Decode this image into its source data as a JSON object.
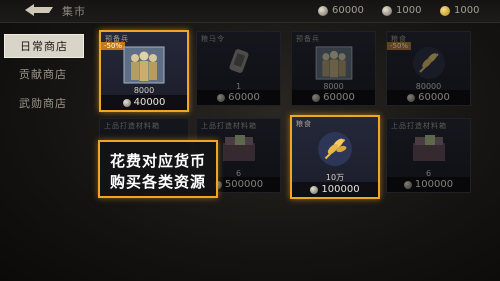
{
  "header": {
    "title": "集市",
    "currencies": [
      {
        "icon": "silver-coin-icon",
        "value": "60000"
      },
      {
        "icon": "silver-coin-icon",
        "value": "1000"
      },
      {
        "icon": "gold-coin-icon",
        "value": "1000"
      }
    ]
  },
  "sidebar": {
    "items": [
      {
        "label": "日常商店",
        "active": true
      },
      {
        "label": "贡献商店",
        "active": false
      },
      {
        "label": "武勋商店",
        "active": false
      }
    ]
  },
  "shop": {
    "cards": [
      {
        "name": "预备兵",
        "discount": "-50%",
        "qty": "8000",
        "price": "40000",
        "art": "soldiers-icon",
        "highlighted": true,
        "dimmed": false
      },
      {
        "name": "粮马令",
        "discount": "",
        "qty": "1",
        "price": "60000",
        "art": "token-icon",
        "highlighted": false,
        "dimmed": true
      },
      {
        "name": "预备兵",
        "discount": "",
        "qty": "8000",
        "price": "60000",
        "art": "soldiers-icon",
        "highlighted": false,
        "dimmed": true
      },
      {
        "name": "粮食",
        "discount": "-50%",
        "qty": "80000",
        "price": "60000",
        "art": "wheat-icon",
        "highlighted": false,
        "dimmed": true
      },
      {
        "name": "上品打造材料箱",
        "discount": "",
        "qty": "",
        "price": "",
        "art": "crate-icon",
        "highlighted": false,
        "dimmed": true
      },
      {
        "name": "上品打造材料箱",
        "discount": "",
        "qty": "6",
        "price": "500000",
        "art": "crate-icon",
        "highlighted": false,
        "dimmed": true
      },
      {
        "name": "粮食",
        "discount": "",
        "qty": "10万",
        "price": "100000",
        "art": "wheat-icon",
        "highlighted": true,
        "dimmed": false
      },
      {
        "name": "上品打造材料箱",
        "discount": "",
        "qty": "6",
        "price": "100000",
        "art": "crate-icon",
        "highlighted": false,
        "dimmed": true
      }
    ]
  },
  "tip": {
    "line1": "花费对应货币",
    "line2": "购买各类资源"
  },
  "colors": {
    "highlight": "#f0a623",
    "active_tab": "#d9d4c8"
  }
}
